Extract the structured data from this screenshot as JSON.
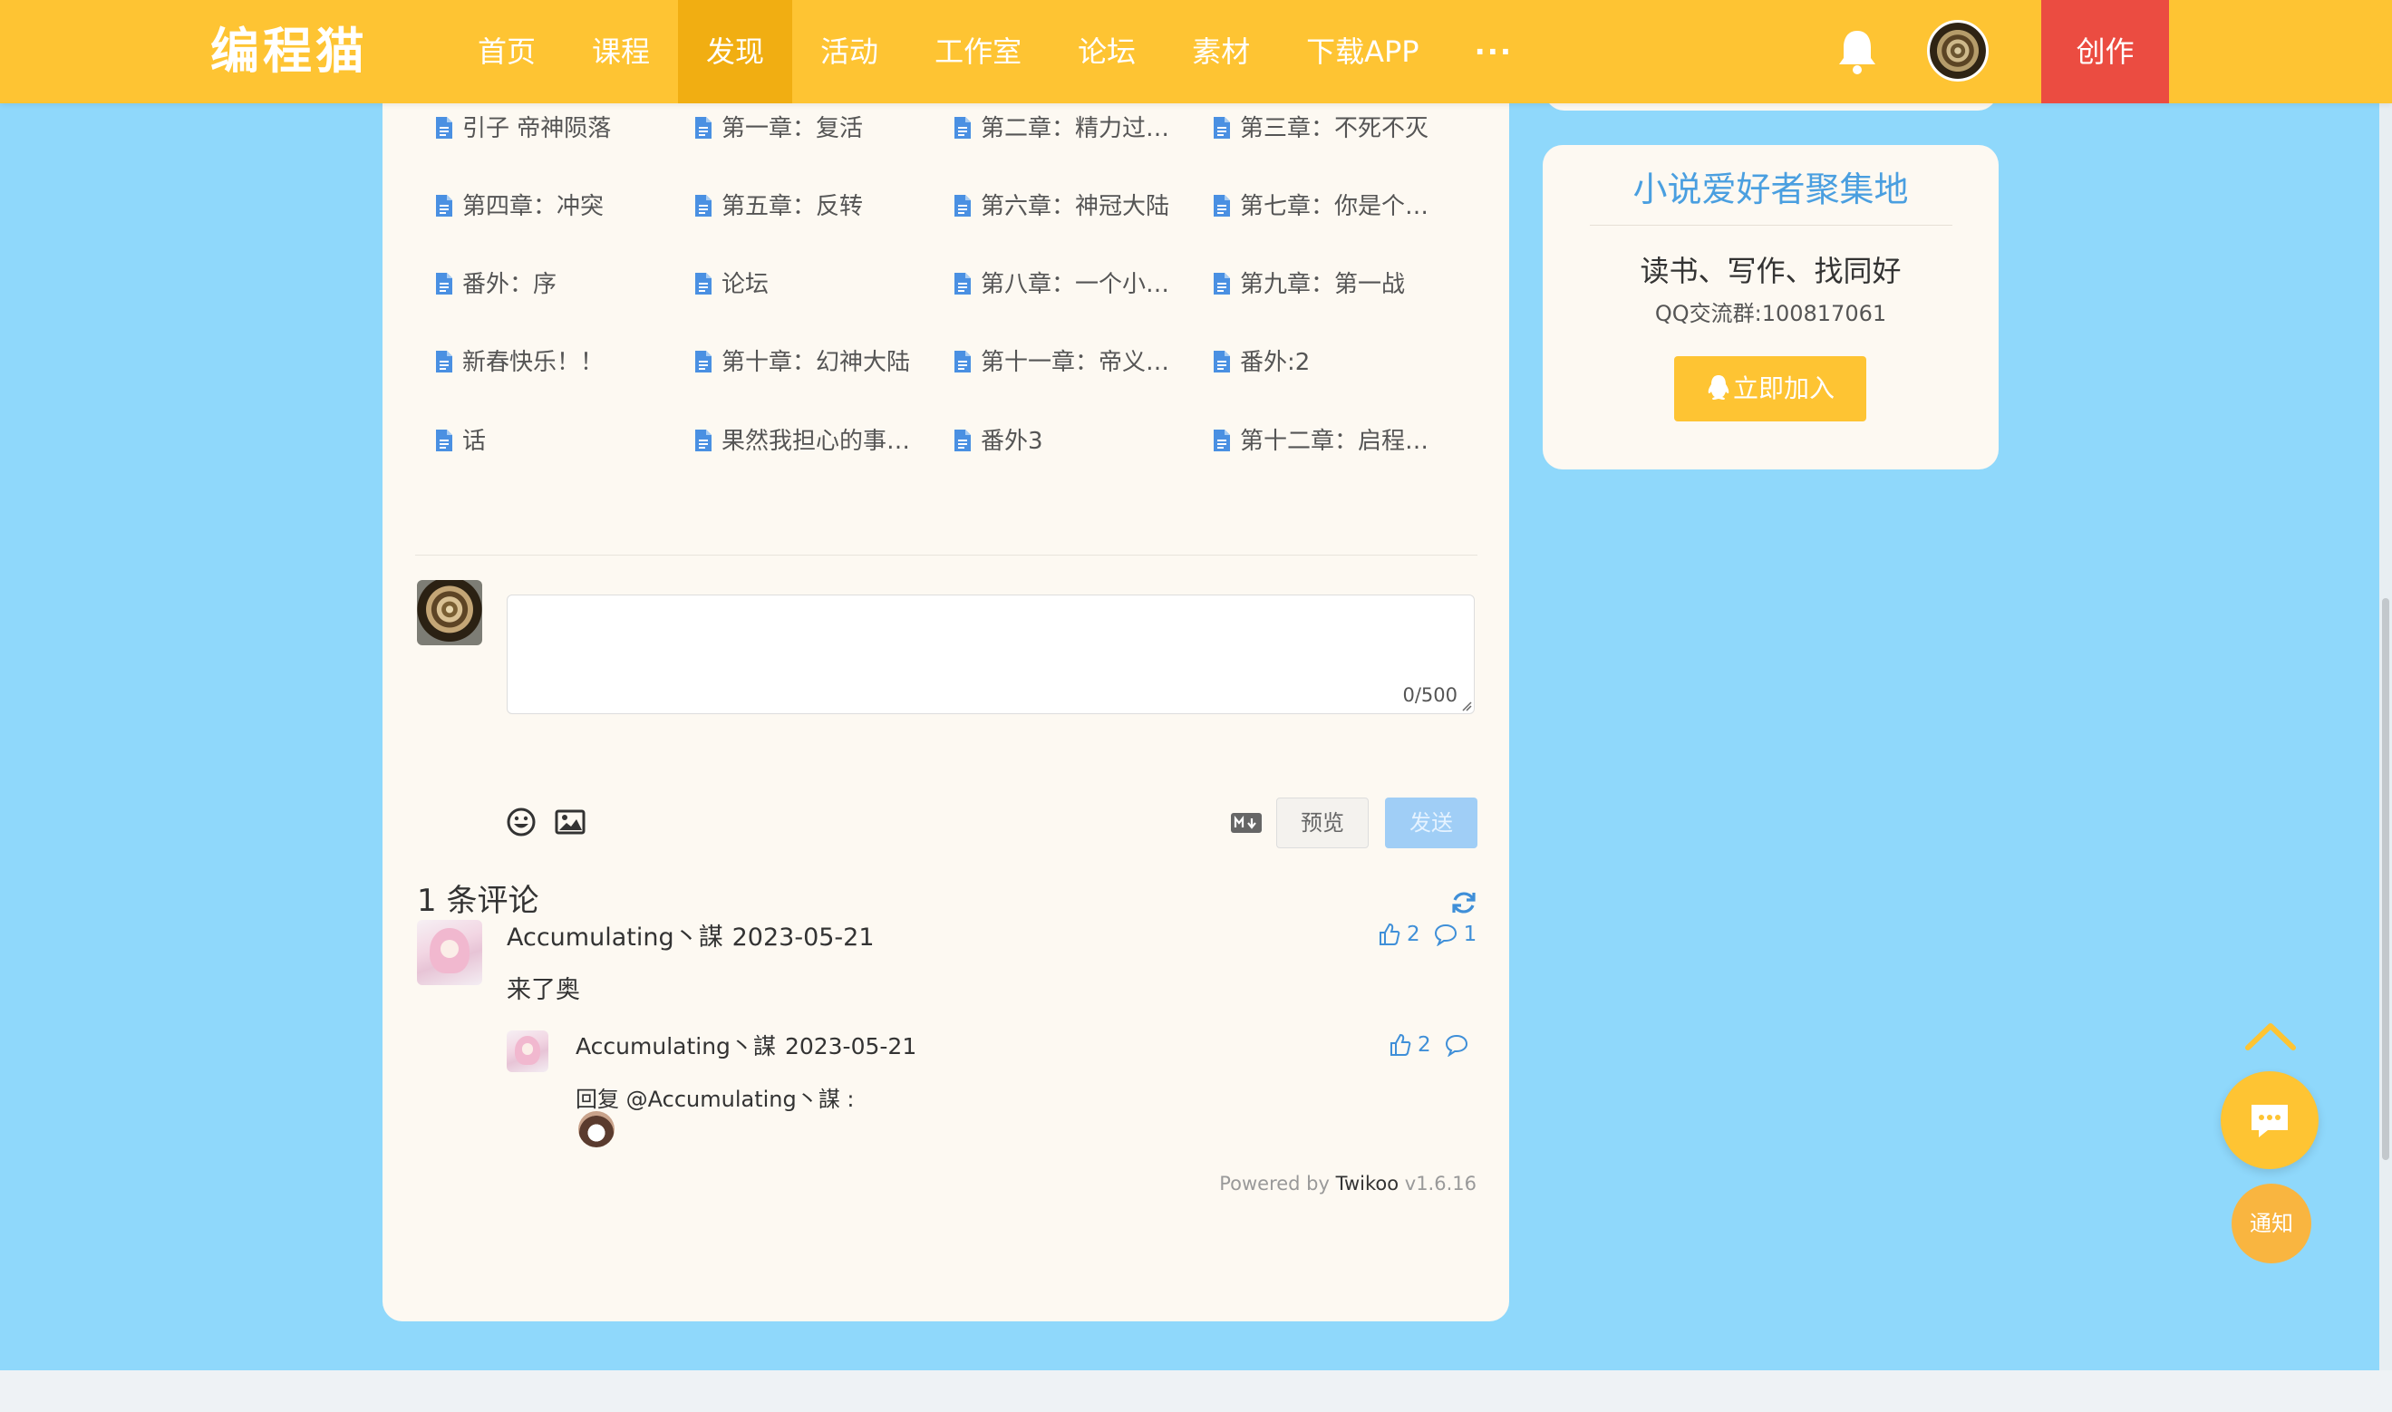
{
  "header": {
    "logo": "编程猫",
    "nav": [
      "首页",
      "课程",
      "发现",
      "活动",
      "工作室",
      "论坛",
      "素材",
      "下载APP"
    ],
    "active_nav": "发现",
    "more": "···",
    "create": "创作"
  },
  "chapters": [
    "引子 帝神陨落",
    "第一章：复活",
    "第二章：精力过…",
    "第三章：不死不灭",
    "第四章：冲突",
    "第五章：反转",
    "第六章：神冠大陆",
    "第七章：你是个…",
    "番外：序",
    "论坛",
    "第八章：一个小…",
    "第九章：第一战",
    "新春快乐！！",
    "第十章：幻神大陆",
    "第十一章：帝义…",
    "番外:2",
    "话",
    "果然我担心的事…",
    "番外3",
    "第十二章：启程…"
  ],
  "editor": {
    "counter": "0/500",
    "preview": "预览",
    "send": "发送"
  },
  "comments_title": "1 条评论",
  "comment": {
    "nick": "Accumulating丶謀",
    "date": "2023-05-21",
    "text": "来了奥",
    "likes": "2",
    "replies": "1"
  },
  "reply": {
    "nick": "Accumulating丶謀",
    "date": "2023-05-21",
    "likes": "2",
    "prefix": "回复 ",
    "mention": "@Accumulating丶謀",
    "suffix": " :"
  },
  "powered": {
    "prefix": "Powered by ",
    "brand": "Twikoo",
    "version": " v1.6.16"
  },
  "side": {
    "title": "小说爱好者聚集地",
    "subtitle": "读书、写作、找同好",
    "qq": "QQ交流群:100817061",
    "join": "立即加入"
  },
  "notify": "通知",
  "colors": {
    "header": "#fec433",
    "active_nav": "#f1ae12",
    "create": "#eb4c41",
    "background": "#8fd8fb",
    "card": "#fdf9f2",
    "accent_blue": "#3f8fd8"
  }
}
